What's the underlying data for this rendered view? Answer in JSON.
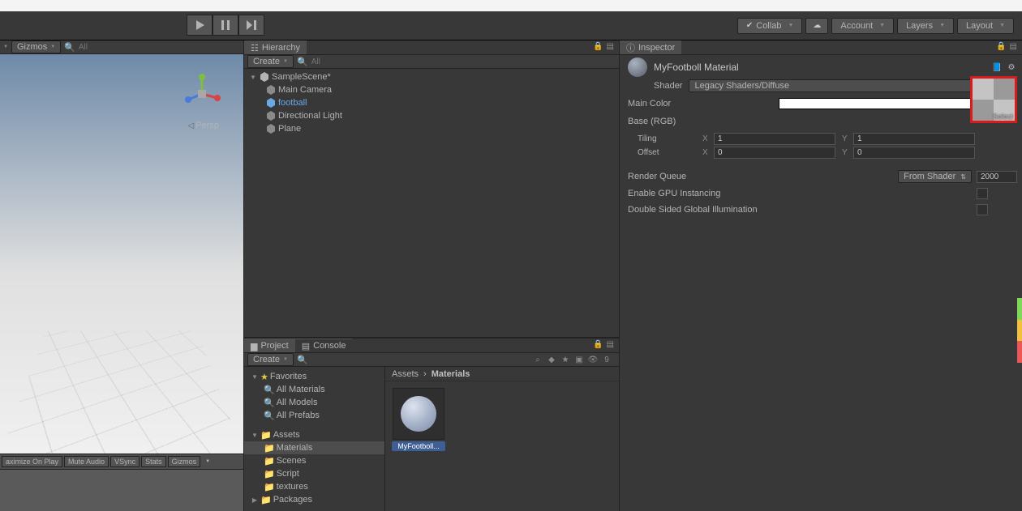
{
  "toolbar": {
    "collab": "Collab",
    "account": "Account",
    "layers": "Layers",
    "layout": "Layout"
  },
  "scene": {
    "gizmos": "Gizmos",
    "search_ph": "All",
    "persp": "Persp",
    "bar": {
      "maximize": "aximize On Play",
      "mute": "Mute Audio",
      "vsync": "VSync",
      "stats": "Stats",
      "gizmos": "Gizmos"
    }
  },
  "hierarchy": {
    "tab": "Hierarchy",
    "create": "Create",
    "search_ph": "All",
    "root": "SampleScene*",
    "items": [
      "Main Camera",
      "football",
      "Directional Light",
      "Plane"
    ]
  },
  "project": {
    "tab_project": "Project",
    "tab_console": "Console",
    "create": "Create",
    "counter": "9",
    "favorites": "Favorites",
    "fav_items": [
      "All Materials",
      "All Models",
      "All Prefabs"
    ],
    "assets": "Assets",
    "asset_folders": [
      "Materials",
      "Scenes",
      "Script",
      "textures"
    ],
    "packages": "Packages",
    "breadcrumb_root": "Assets",
    "breadcrumb_cur": "Materials",
    "grid_item": "MyFootboll..."
  },
  "inspector": {
    "tab": "Inspector",
    "mat_name": "MyFootboll Material",
    "shader_lbl": "Shader",
    "shader_val": "Legacy Shaders/Diffuse",
    "main_color": "Main Color",
    "base_rgb": "Base (RGB)",
    "tiling": "Tiling",
    "offset": "Offset",
    "tiling_x": "1",
    "tiling_y": "1",
    "offset_x": "0",
    "offset_y": "0",
    "tex_select": "Select",
    "render_queue": "Render Queue",
    "rq_mode": "From Shader",
    "rq_val": "2000",
    "gpu_inst": "Enable GPU Instancing",
    "dsgi": "Double Sided Global Illumination"
  }
}
